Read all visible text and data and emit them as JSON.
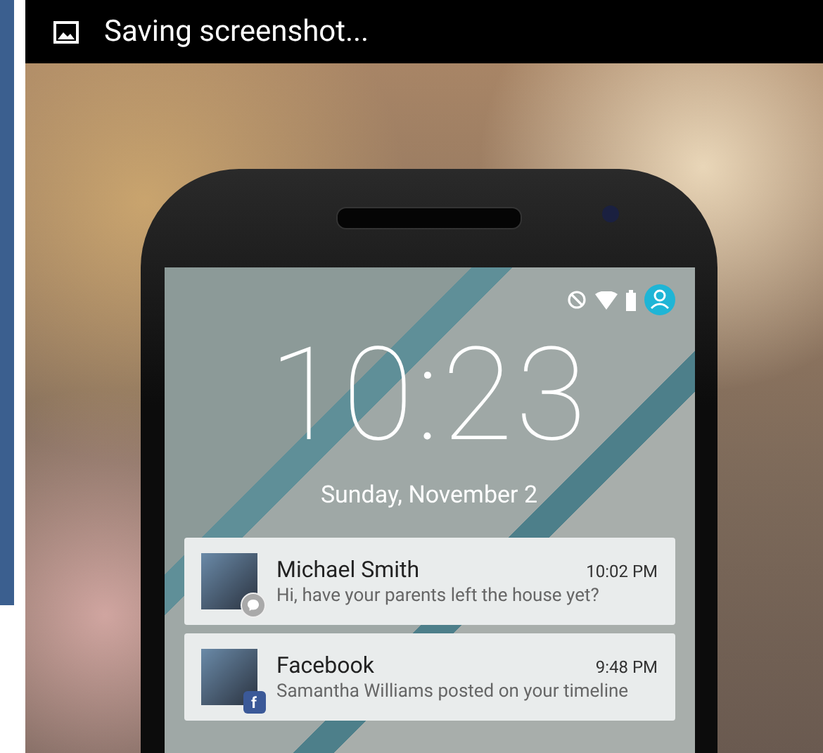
{
  "notification_bar": {
    "text": "Saving screenshot..."
  },
  "lock_screen": {
    "time": "10:23",
    "date": "Sunday, November 2"
  },
  "notifications": [
    {
      "sender": "Michael Smith",
      "time": "10:02 PM",
      "message": "Hi, have your parents left the house yet?",
      "badge": {
        "kind": "messenger"
      }
    },
    {
      "sender": "Facebook",
      "time": "9:48 PM",
      "message": "Samantha Williams posted on your timeline",
      "badge": {
        "kind": "facebook",
        "text": "f"
      }
    }
  ]
}
